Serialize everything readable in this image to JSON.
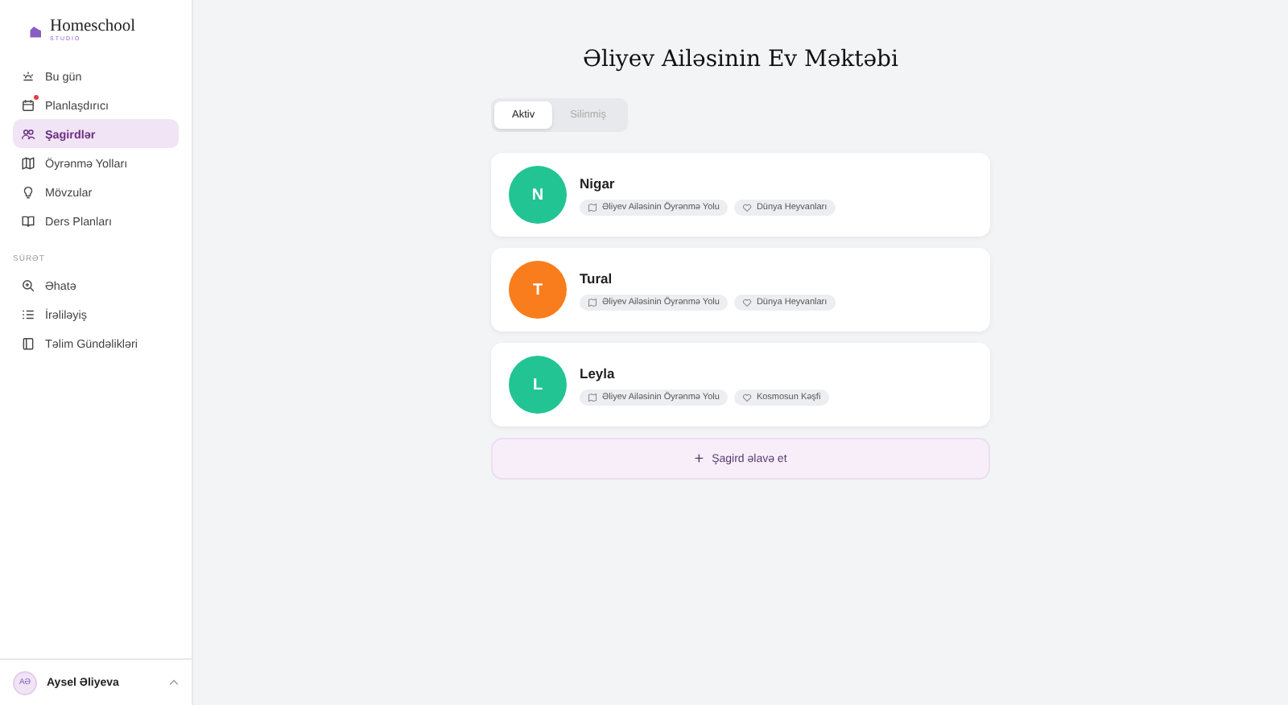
{
  "logo": {
    "name": "Homeschool",
    "subtitle": "STUDIO"
  },
  "nav": [
    {
      "label": "Bu gün",
      "kind": "sun",
      "selected": false,
      "badge": false
    },
    {
      "label": "Planlaşdırıcı",
      "kind": "calendar",
      "selected": false,
      "badge": true
    },
    {
      "label": "Şagirdlər",
      "kind": "users",
      "selected": true,
      "badge": false
    },
    {
      "label": "Öyrənmə Yolları",
      "kind": "map",
      "selected": false,
      "badge": false
    },
    {
      "label": "Mövzular",
      "kind": "bulb",
      "selected": false,
      "badge": false
    },
    {
      "label": "Ders Planları",
      "kind": "book",
      "selected": false,
      "badge": false
    }
  ],
  "section_label": "SÜRƏT",
  "nav2": [
    {
      "label": "Əhatə",
      "kind": "zoom",
      "selected": false,
      "badge": false
    },
    {
      "label": "İrəliləyiş",
      "kind": "list",
      "selected": false,
      "badge": false
    },
    {
      "label": "Təlim Gündəlikləri",
      "kind": "journal",
      "selected": false,
      "badge": false
    }
  ],
  "user": {
    "initials": "AƏ",
    "name": "Aysel Əliyeva"
  },
  "title": "Əliyev Ailəsinin Ev Məktəbi",
  "tabs": [
    {
      "label": "Aktiv",
      "selected": true
    },
    {
      "label": "Silinmiş",
      "selected": false
    }
  ],
  "students": [
    {
      "initial": "N",
      "name": "Nigar",
      "color": "#22c493",
      "path": "Əliyev Ailəsinin Öyrənmə Yolu",
      "topic": "Dünya Heyvanları"
    },
    {
      "initial": "T",
      "name": "Tural",
      "color": "#f97d1c",
      "path": "Əliyev Ailəsinin Öyrənmə Yolu",
      "topic": "Dünya Heyvanları"
    },
    {
      "initial": "L",
      "name": "Leyla",
      "color": "#22c493",
      "path": "Əliyev Ailəsinin Öyrənmə Yolu",
      "topic": "Kosmosun Kəşfi"
    }
  ],
  "add_button": {
    "icon": "+",
    "label": "Şagird əlavə et"
  }
}
